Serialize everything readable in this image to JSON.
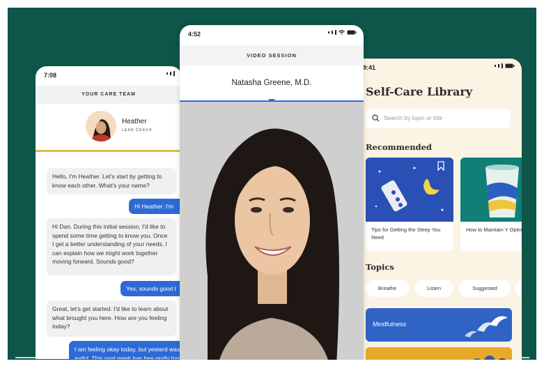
{
  "care_phone": {
    "time": "7:08",
    "header": "YOUR CARE TEAM",
    "coach_name": "Heather",
    "coach_role": "LEAD COACH",
    "messages": [
      {
        "dir": "in",
        "text": "Hello, I'm Heather. Let's start by getting to know each other. What's your name?"
      },
      {
        "dir": "out",
        "text": "Hi Heather. I'm"
      },
      {
        "dir": "in",
        "text": "Hi Dan. During this initial session, I'd like to spend some time getting to know you. Once I get a better understanding of your needs, I can explain how we might work together moving forward. Sounds good?"
      },
      {
        "dir": "out",
        "text": "Yes, sounds good t"
      },
      {
        "dir": "in",
        "text": "Great, let's get started. I'd like to learn about what brought you here. How are you feeling today?"
      },
      {
        "dir": "out",
        "text": "I am feeling okay today, but yesterd was awful. This past week has bee really hard for me"
      }
    ]
  },
  "video_phone": {
    "time": "4:52",
    "header": "VIDEO SESSION",
    "doctor": "Natasha Greene, M.D."
  },
  "library_phone": {
    "time": "9:41",
    "title": "Self-Care Library",
    "search_placeholder": "Search by topic or title",
    "recommended_label": "Recommended",
    "cards": [
      "Tips for Getting the Sleep You Need",
      "How to Maintain Y Optimism"
    ],
    "topics_label": "Topics",
    "chips": [
      "Breathe",
      "Listen",
      "Suggested"
    ],
    "topic_cards": [
      "Mindfulness"
    ]
  },
  "colors": {
    "background": "#0d5649",
    "accent_blue": "#2d6ad6",
    "coach_divider": "#e3b84a",
    "library_bg": "#fbf3e4"
  }
}
